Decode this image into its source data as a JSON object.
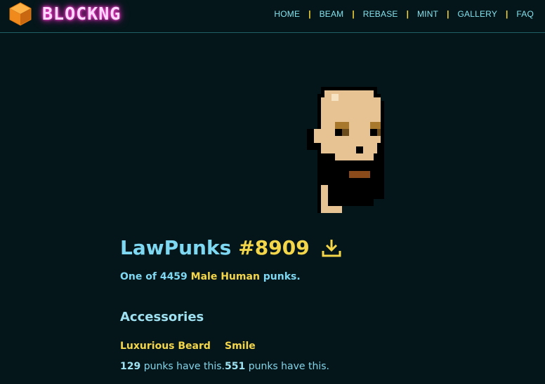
{
  "header": {
    "logo_text": "BLOCKNG",
    "logo_icon": "orange-cube-icon",
    "nav": [
      {
        "label": "HOME"
      },
      {
        "label": "BEAM"
      },
      {
        "label": "REBASE"
      },
      {
        "label": "MINT"
      },
      {
        "label": "GALLERY"
      },
      {
        "label": "FAQ"
      }
    ],
    "nav_separator": "|"
  },
  "punk": {
    "image": "pixel-art-punk",
    "collection": "LawPunks",
    "number": "#8909",
    "download_icon": "download-icon"
  },
  "summary": {
    "prefix": "One of",
    "count": "4459",
    "type": "Male Human",
    "suffix": "punks."
  },
  "accessories": {
    "title": "Accessories",
    "items": [
      {
        "name": "Luxurious Beard",
        "count": "129",
        "suffix": "punks have this."
      },
      {
        "name": "Smile",
        "count": "551",
        "suffix": "punks have this."
      }
    ]
  },
  "colors": {
    "background": "#041619",
    "cyan": "#7fd8f2",
    "yellow": "#f4d64b",
    "neon_pink": "#ff2fc8",
    "cube_orange": "#f08a1c"
  }
}
